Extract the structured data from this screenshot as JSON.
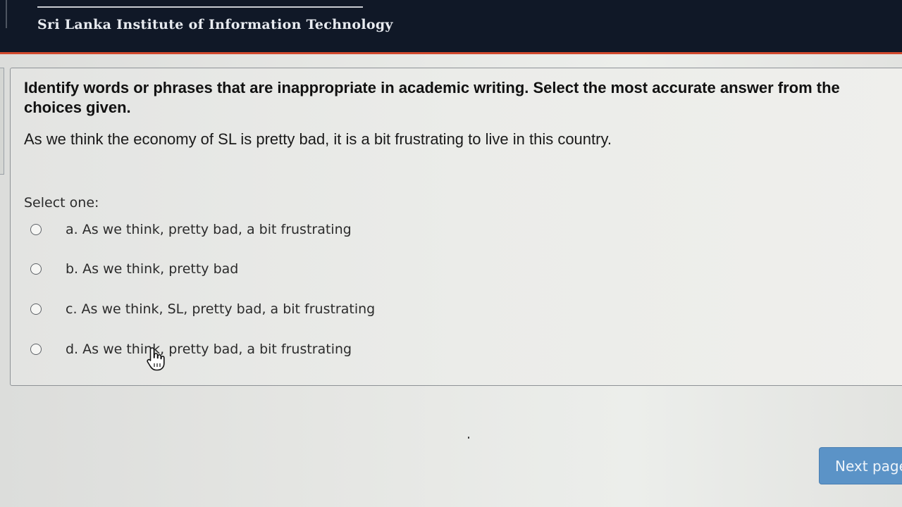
{
  "header": {
    "institution": "Sri Lanka Institute of Information Technology"
  },
  "question": {
    "instruction": "Identify words or phrases that are inappropriate in academic writing. Select the most accurate answer from the choices given.",
    "stem": "As we think the economy of SL is pretty bad, it is a bit frustrating to live in this country.",
    "prompt": "Select one:",
    "options": [
      {
        "label": "a. As we think, pretty bad, a bit frustrating"
      },
      {
        "label": "b. As we think, pretty bad"
      },
      {
        "label": "c. As we think, SL, pretty bad, a bit frustrating"
      },
      {
        "label": "d. As we think, pretty bad, a bit frustrating"
      }
    ]
  },
  "navigation": {
    "next_label": "Next page"
  },
  "colors": {
    "header_bg": "#101827",
    "header_accent": "#d24a2e",
    "button_bg": "#5b93c7"
  }
}
